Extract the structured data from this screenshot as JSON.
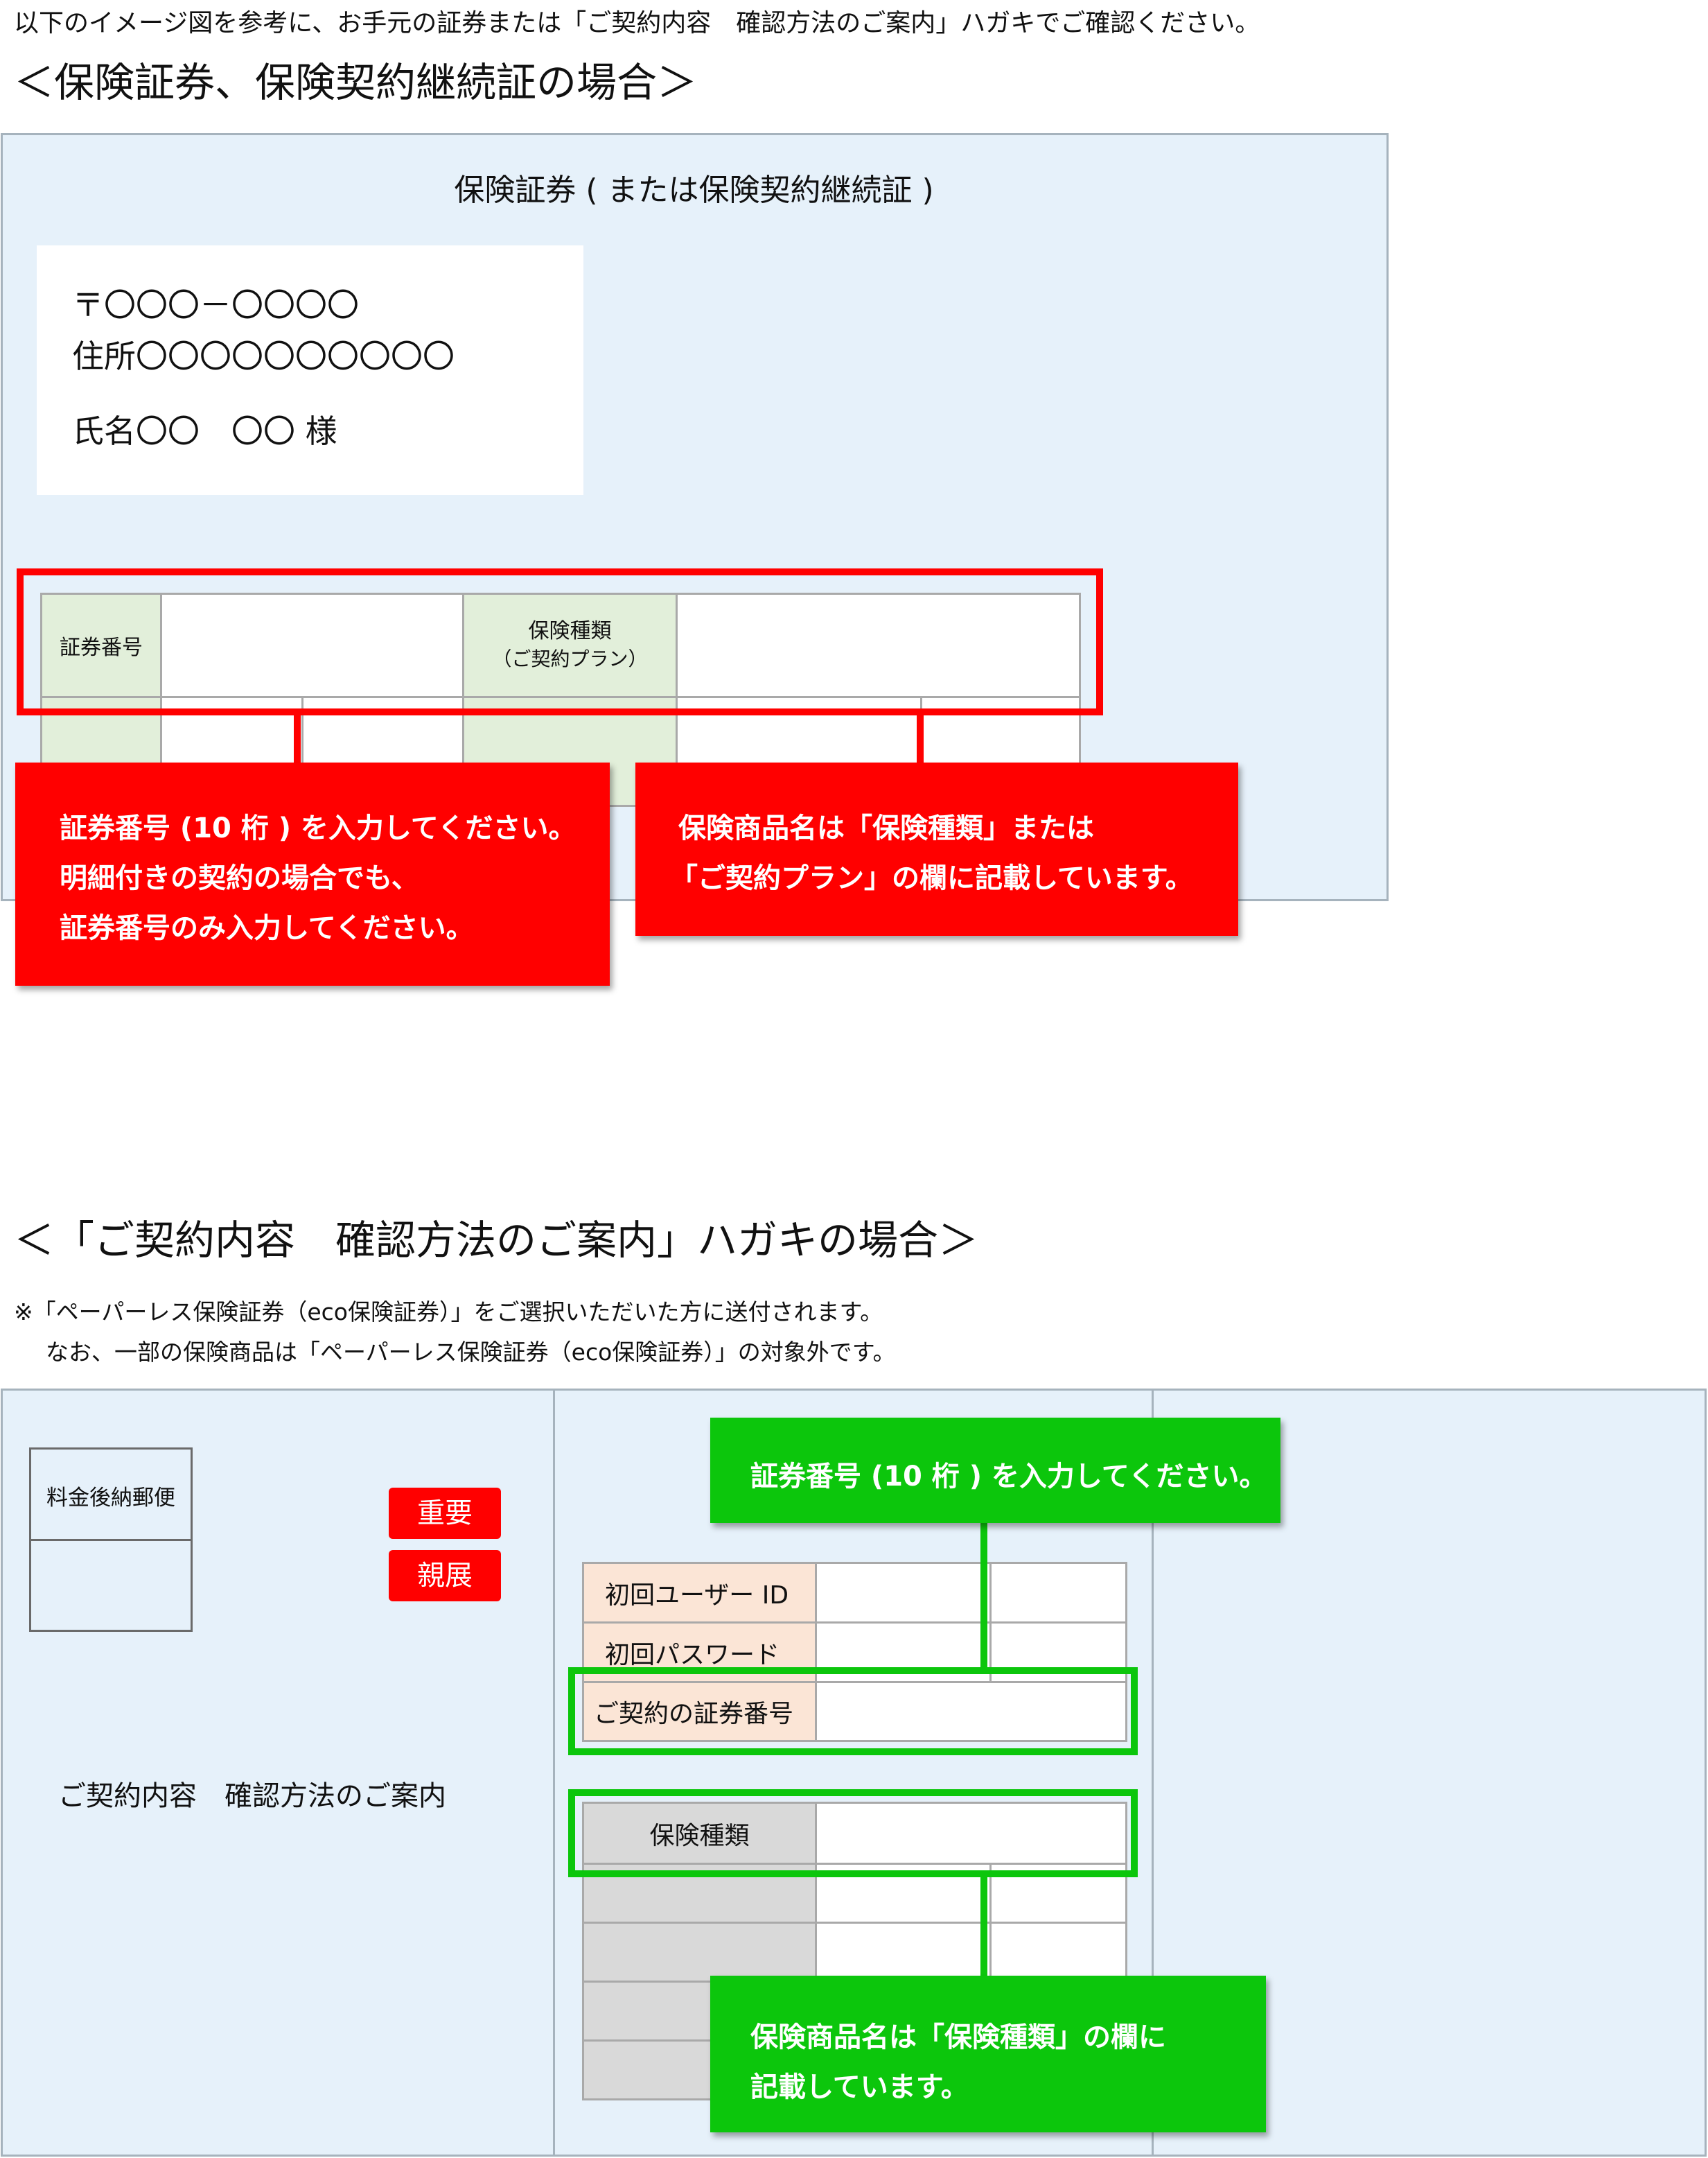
{
  "intro": "以下のイメージ図を参考に、お手元の証券または「ご契約内容　確認方法のご案内」ハガキでご確認ください。",
  "section1": {
    "heading": "＜保険証券、保険契約継続証の場合＞",
    "doc_title": "保険証券 ( または保険契約継続証 )",
    "address": {
      "zip": "〒〇〇〇－〇〇〇〇",
      "addr": "住所〇〇〇〇〇〇〇〇〇〇",
      "name": "氏名〇〇　〇〇 様"
    },
    "table": {
      "policy_no_label": "証券番号",
      "type_label_1": "保険種類",
      "type_label_2": "（ご契約プラン）"
    },
    "callout_left": [
      "証券番号 (10 桁 ) を入力してください。",
      "明細付きの契約の場合でも、",
      "証券番号のみ入力してください。"
    ],
    "callout_right": [
      "保険商品名は「保険種類」または",
      "「ご契約プラン」の欄に記載しています。"
    ]
  },
  "section2": {
    "heading": "＜「ご契約内容　確認方法のご案内」ハガキの場合＞",
    "notes": [
      "※「ペーパーレス保険証券（eco保険証券）」をご選択いただいた方に送付されます。",
      "なお、一部の保険商品は「ペーパーレス保険証券（eco保険証券）」の対象外です。"
    ],
    "stamp_label": "料金後納郵便",
    "tags": [
      "重要",
      "親展"
    ],
    "card_title": "ご契約内容　確認方法のご案内",
    "rows": [
      "初回ユーザー ID",
      "初回パスワード",
      "ご契約の証券番号"
    ],
    "type_label": "保険種類",
    "callout_top": "証券番号 (10 桁 ) を入力してください。",
    "callout_bottom": [
      "保険商品名は「保険種類」の欄に",
      "記載しています。"
    ]
  },
  "colors": {
    "panel_bg": "#e6f1fa",
    "red_accent": "#ff0000",
    "green_accent": "#0cc60c",
    "policy_label_bg": "#e2efda",
    "login_label_bg": "#fbe5d6",
    "type_label_bg": "#d9d9d9"
  }
}
